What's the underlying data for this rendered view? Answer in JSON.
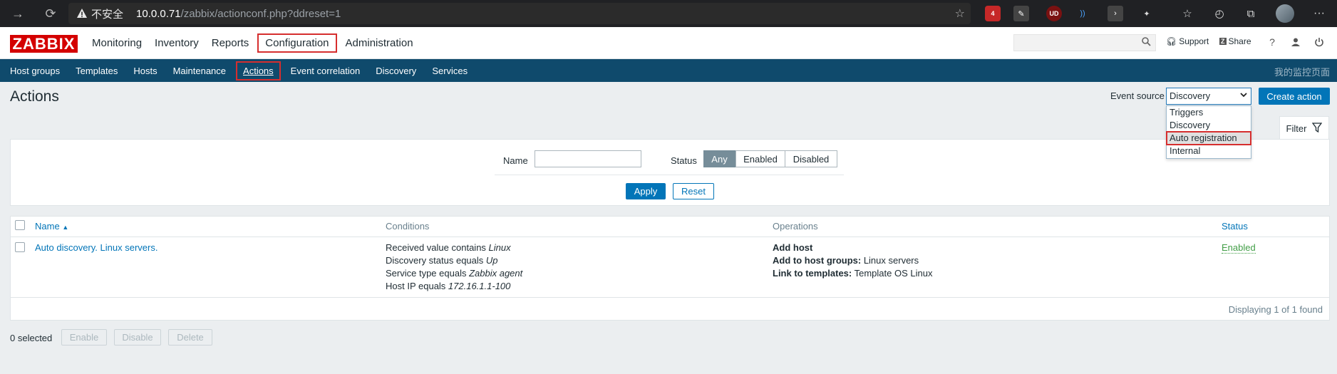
{
  "browser": {
    "insecure_label": "不安全",
    "url_host": "10.0.0.71",
    "url_path": "/zabbix/actionconf.php?ddreset=1",
    "ext_badge": "4",
    "ublock_label": "UD"
  },
  "header": {
    "logo": "ZABBIX",
    "menu": [
      "Monitoring",
      "Inventory",
      "Reports",
      "Configuration",
      "Administration"
    ],
    "active_menu": "Configuration",
    "support": "Support",
    "share": "Share",
    "help": "?"
  },
  "submenu": {
    "items": [
      "Host groups",
      "Templates",
      "Hosts",
      "Maintenance",
      "Actions",
      "Event correlation",
      "Discovery",
      "Services"
    ],
    "active": "Actions",
    "right_text": "我的监控页面"
  },
  "page": {
    "title": "Actions",
    "event_source_label": "Event source",
    "event_source_value": "Discovery",
    "create_button": "Create action",
    "dropdown_options": [
      "Triggers",
      "Discovery",
      "Auto registration",
      "Internal"
    ],
    "highlighted_option": "Auto registration"
  },
  "filter": {
    "tab_label": "Filter",
    "name_label": "Name",
    "name_value": "",
    "status_label": "Status",
    "status_options": [
      "Any",
      "Enabled",
      "Disabled"
    ],
    "status_selected": "Any",
    "apply": "Apply",
    "reset": "Reset"
  },
  "table": {
    "columns": {
      "name": "Name",
      "name_sort": "▲",
      "conditions": "Conditions",
      "operations": "Operations",
      "status": "Status"
    },
    "row": {
      "name": "Auto discovery. Linux servers.",
      "conditions": [
        {
          "text": "Received value contains ",
          "value": "Linux"
        },
        {
          "text": "Discovery status equals ",
          "value": "Up"
        },
        {
          "text": "Service type equals ",
          "value": "Zabbix agent"
        },
        {
          "text": "Host IP equals ",
          "value": "172.16.1.1-100"
        }
      ],
      "operations": [
        {
          "label": "Add host",
          "value": ""
        },
        {
          "label": "Add to host groups:",
          "value": " Linux servers"
        },
        {
          "label": "Link to templates:",
          "value": " Template OS Linux"
        }
      ],
      "status": "Enabled"
    },
    "displaying": "Displaying 1 of 1 found"
  },
  "footer": {
    "selected": "0 selected",
    "enable": "Enable",
    "disable": "Disable",
    "delete": "Delete"
  },
  "colors": {
    "brand_red": "#d40000",
    "nav_blue": "#0f4a6c",
    "primary_button": "#0275b8",
    "status_green": "#429e47",
    "highlight_box": "#d62e2e"
  }
}
